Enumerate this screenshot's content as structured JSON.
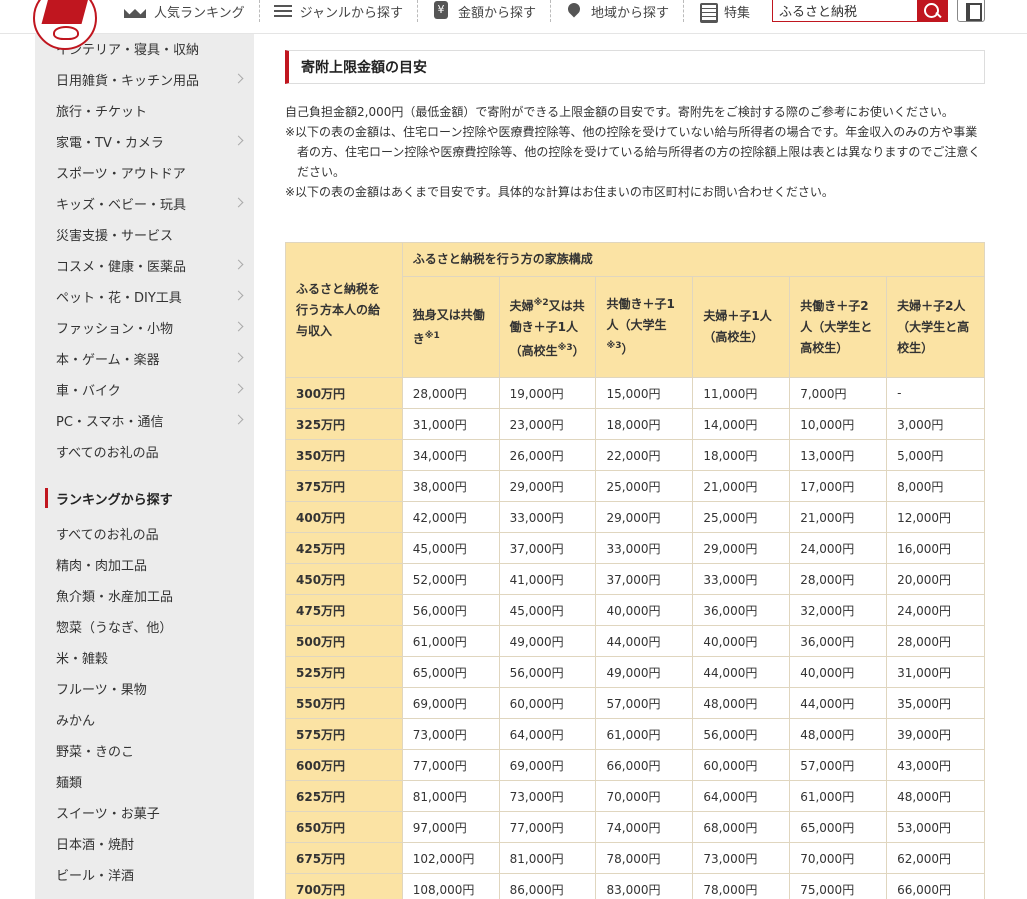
{
  "header": {
    "nav": [
      {
        "label": "人気ランキング",
        "icon": "crown-icon"
      },
      {
        "label": "ジャンルから探す",
        "icon": "list-icon"
      },
      {
        "label": "金額から探す",
        "icon": "money-icon"
      },
      {
        "label": "地域から探す",
        "icon": "pin-icon"
      },
      {
        "label": "特集",
        "icon": "document-icon"
      }
    ],
    "search_value": "ふるさと納税"
  },
  "sidebar": {
    "categories": [
      {
        "label": "インテリア・寝具・収納",
        "arrow": false
      },
      {
        "label": "日用雑貨・キッチン用品",
        "arrow": true
      },
      {
        "label": "旅行・チケット",
        "arrow": false
      },
      {
        "label": "家電・TV・カメラ",
        "arrow": true
      },
      {
        "label": "スポーツ・アウトドア",
        "arrow": false
      },
      {
        "label": "キッズ・ベビー・玩具",
        "arrow": true
      },
      {
        "label": "災害支援・サービス",
        "arrow": false
      },
      {
        "label": "コスメ・健康・医薬品",
        "arrow": true
      },
      {
        "label": "ペット・花・DIY工具",
        "arrow": true
      },
      {
        "label": "ファッション・小物",
        "arrow": true
      },
      {
        "label": "本・ゲーム・楽器",
        "arrow": true
      },
      {
        "label": "車・バイク",
        "arrow": true
      },
      {
        "label": "PC・スマホ・通信",
        "arrow": true
      },
      {
        "label": "すべてのお礼の品",
        "arrow": false
      }
    ],
    "ranking_heading": "ランキングから探す",
    "ranking_items": [
      "すべてのお礼の品",
      "精肉・肉加工品",
      "魚介類・水産加工品",
      "惣菜（うなぎ、他）",
      "米・雑穀",
      "フルーツ・果物",
      "みかん",
      "野菜・きのこ",
      "麺類",
      "スイーツ・お菓子",
      "日本酒・焼酎",
      "ビール・洋酒"
    ]
  },
  "main": {
    "title": "寄附上限金額の目安",
    "desc1": "自己負担金額2,000円（最低金額）で寄附ができる上限金額の目安です。寄附先をご検討する際のご参考にお使いください。",
    "note1": "※以下の表の金額は、住宅ローン控除や医療費控除等、他の控除を受けていない給与所得者の場合です。年金収入のみの方や事業者の方、住宅ローン控除や医療費控除等、他の控除を受けている給与所得者の方の控除額上限は表とは異なりますのでご注意ください。",
    "note2": "※以下の表の金額はあくまで目安です。具体的な計算はお住まいの市区町村にお問い合わせください。",
    "table": {
      "corner": "ふるさと納税を行う方本人の給与収入",
      "group": "ふるさと納税を行う方の家族構成",
      "col1": "独身又は共働き",
      "col1_sup": "※1",
      "col2_a": "夫婦",
      "col2_sup": "※2",
      "col2_b": "又は共働き＋子1人（高校生",
      "col2_sup2": "※3",
      "col2_c": "）",
      "col3_a": "共働き＋子1人（大学生",
      "col3_sup": "※3",
      "col3_b": "）",
      "col4": "夫婦＋子1人（高校生）",
      "col5": "共働き＋子2人（大学生と高校生）",
      "col6": "夫婦＋子2人（大学生と高校生）",
      "rows": [
        [
          "300万円",
          "28,000円",
          "19,000円",
          "15,000円",
          "11,000円",
          "7,000円",
          "-"
        ],
        [
          "325万円",
          "31,000円",
          "23,000円",
          "18,000円",
          "14,000円",
          "10,000円",
          "3,000円"
        ],
        [
          "350万円",
          "34,000円",
          "26,000円",
          "22,000円",
          "18,000円",
          "13,000円",
          "5,000円"
        ],
        [
          "375万円",
          "38,000円",
          "29,000円",
          "25,000円",
          "21,000円",
          "17,000円",
          "8,000円"
        ],
        [
          "400万円",
          "42,000円",
          "33,000円",
          "29,000円",
          "25,000円",
          "21,000円",
          "12,000円"
        ],
        [
          "425万円",
          "45,000円",
          "37,000円",
          "33,000円",
          "29,000円",
          "24,000円",
          "16,000円"
        ],
        [
          "450万円",
          "52,000円",
          "41,000円",
          "37,000円",
          "33,000円",
          "28,000円",
          "20,000円"
        ],
        [
          "475万円",
          "56,000円",
          "45,000円",
          "40,000円",
          "36,000円",
          "32,000円",
          "24,000円"
        ],
        [
          "500万円",
          "61,000円",
          "49,000円",
          "44,000円",
          "40,000円",
          "36,000円",
          "28,000円"
        ],
        [
          "525万円",
          "65,000円",
          "56,000円",
          "49,000円",
          "44,000円",
          "40,000円",
          "31,000円"
        ],
        [
          "550万円",
          "69,000円",
          "60,000円",
          "57,000円",
          "48,000円",
          "44,000円",
          "35,000円"
        ],
        [
          "575万円",
          "73,000円",
          "64,000円",
          "61,000円",
          "56,000円",
          "48,000円",
          "39,000円"
        ],
        [
          "600万円",
          "77,000円",
          "69,000円",
          "66,000円",
          "60,000円",
          "57,000円",
          "43,000円"
        ],
        [
          "625万円",
          "81,000円",
          "73,000円",
          "70,000円",
          "64,000円",
          "61,000円",
          "48,000円"
        ],
        [
          "650万円",
          "97,000円",
          "77,000円",
          "74,000円",
          "68,000円",
          "65,000円",
          "53,000円"
        ],
        [
          "675万円",
          "102,000円",
          "81,000円",
          "78,000円",
          "73,000円",
          "70,000円",
          "62,000円"
        ],
        [
          "700万円",
          "108,000円",
          "86,000円",
          "83,000円",
          "78,000円",
          "75,000円",
          "66,000円"
        ]
      ]
    }
  },
  "colors": {
    "accent": "#c0161f",
    "table_header": "#fbe3a4",
    "sidebar_bg": "#ececec"
  }
}
